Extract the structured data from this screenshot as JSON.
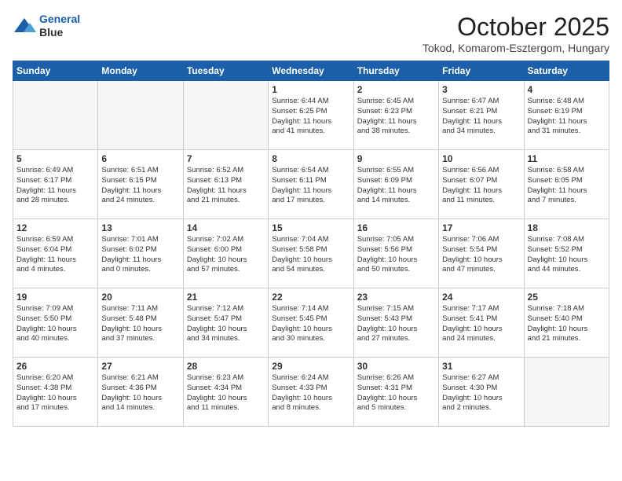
{
  "header": {
    "logo_line1": "General",
    "logo_line2": "Blue",
    "month": "October 2025",
    "location": "Tokod, Komarom-Esztergom, Hungary"
  },
  "weekdays": [
    "Sunday",
    "Monday",
    "Tuesday",
    "Wednesday",
    "Thursday",
    "Friday",
    "Saturday"
  ],
  "weeks": [
    [
      {
        "day": "",
        "info": "",
        "shaded": true
      },
      {
        "day": "",
        "info": "",
        "shaded": true
      },
      {
        "day": "",
        "info": "",
        "shaded": true
      },
      {
        "day": "1",
        "info": "Sunrise: 6:44 AM\nSunset: 6:25 PM\nDaylight: 11 hours\nand 41 minutes."
      },
      {
        "day": "2",
        "info": "Sunrise: 6:45 AM\nSunset: 6:23 PM\nDaylight: 11 hours\nand 38 minutes."
      },
      {
        "day": "3",
        "info": "Sunrise: 6:47 AM\nSunset: 6:21 PM\nDaylight: 11 hours\nand 34 minutes."
      },
      {
        "day": "4",
        "info": "Sunrise: 6:48 AM\nSunset: 6:19 PM\nDaylight: 11 hours\nand 31 minutes."
      }
    ],
    [
      {
        "day": "5",
        "info": "Sunrise: 6:49 AM\nSunset: 6:17 PM\nDaylight: 11 hours\nand 28 minutes."
      },
      {
        "day": "6",
        "info": "Sunrise: 6:51 AM\nSunset: 6:15 PM\nDaylight: 11 hours\nand 24 minutes."
      },
      {
        "day": "7",
        "info": "Sunrise: 6:52 AM\nSunset: 6:13 PM\nDaylight: 11 hours\nand 21 minutes."
      },
      {
        "day": "8",
        "info": "Sunrise: 6:54 AM\nSunset: 6:11 PM\nDaylight: 11 hours\nand 17 minutes."
      },
      {
        "day": "9",
        "info": "Sunrise: 6:55 AM\nSunset: 6:09 PM\nDaylight: 11 hours\nand 14 minutes."
      },
      {
        "day": "10",
        "info": "Sunrise: 6:56 AM\nSunset: 6:07 PM\nDaylight: 11 hours\nand 11 minutes."
      },
      {
        "day": "11",
        "info": "Sunrise: 6:58 AM\nSunset: 6:05 PM\nDaylight: 11 hours\nand 7 minutes."
      }
    ],
    [
      {
        "day": "12",
        "info": "Sunrise: 6:59 AM\nSunset: 6:04 PM\nDaylight: 11 hours\nand 4 minutes."
      },
      {
        "day": "13",
        "info": "Sunrise: 7:01 AM\nSunset: 6:02 PM\nDaylight: 11 hours\nand 0 minutes."
      },
      {
        "day": "14",
        "info": "Sunrise: 7:02 AM\nSunset: 6:00 PM\nDaylight: 10 hours\nand 57 minutes."
      },
      {
        "day": "15",
        "info": "Sunrise: 7:04 AM\nSunset: 5:58 PM\nDaylight: 10 hours\nand 54 minutes."
      },
      {
        "day": "16",
        "info": "Sunrise: 7:05 AM\nSunset: 5:56 PM\nDaylight: 10 hours\nand 50 minutes."
      },
      {
        "day": "17",
        "info": "Sunrise: 7:06 AM\nSunset: 5:54 PM\nDaylight: 10 hours\nand 47 minutes."
      },
      {
        "day": "18",
        "info": "Sunrise: 7:08 AM\nSunset: 5:52 PM\nDaylight: 10 hours\nand 44 minutes."
      }
    ],
    [
      {
        "day": "19",
        "info": "Sunrise: 7:09 AM\nSunset: 5:50 PM\nDaylight: 10 hours\nand 40 minutes."
      },
      {
        "day": "20",
        "info": "Sunrise: 7:11 AM\nSunset: 5:48 PM\nDaylight: 10 hours\nand 37 minutes."
      },
      {
        "day": "21",
        "info": "Sunrise: 7:12 AM\nSunset: 5:47 PM\nDaylight: 10 hours\nand 34 minutes."
      },
      {
        "day": "22",
        "info": "Sunrise: 7:14 AM\nSunset: 5:45 PM\nDaylight: 10 hours\nand 30 minutes."
      },
      {
        "day": "23",
        "info": "Sunrise: 7:15 AM\nSunset: 5:43 PM\nDaylight: 10 hours\nand 27 minutes."
      },
      {
        "day": "24",
        "info": "Sunrise: 7:17 AM\nSunset: 5:41 PM\nDaylight: 10 hours\nand 24 minutes."
      },
      {
        "day": "25",
        "info": "Sunrise: 7:18 AM\nSunset: 5:40 PM\nDaylight: 10 hours\nand 21 minutes."
      }
    ],
    [
      {
        "day": "26",
        "info": "Sunrise: 6:20 AM\nSunset: 4:38 PM\nDaylight: 10 hours\nand 17 minutes."
      },
      {
        "day": "27",
        "info": "Sunrise: 6:21 AM\nSunset: 4:36 PM\nDaylight: 10 hours\nand 14 minutes."
      },
      {
        "day": "28",
        "info": "Sunrise: 6:23 AM\nSunset: 4:34 PM\nDaylight: 10 hours\nand 11 minutes."
      },
      {
        "day": "29",
        "info": "Sunrise: 6:24 AM\nSunset: 4:33 PM\nDaylight: 10 hours\nand 8 minutes."
      },
      {
        "day": "30",
        "info": "Sunrise: 6:26 AM\nSunset: 4:31 PM\nDaylight: 10 hours\nand 5 minutes."
      },
      {
        "day": "31",
        "info": "Sunrise: 6:27 AM\nSunset: 4:30 PM\nDaylight: 10 hours\nand 2 minutes."
      },
      {
        "day": "",
        "info": "",
        "shaded": true
      }
    ]
  ]
}
